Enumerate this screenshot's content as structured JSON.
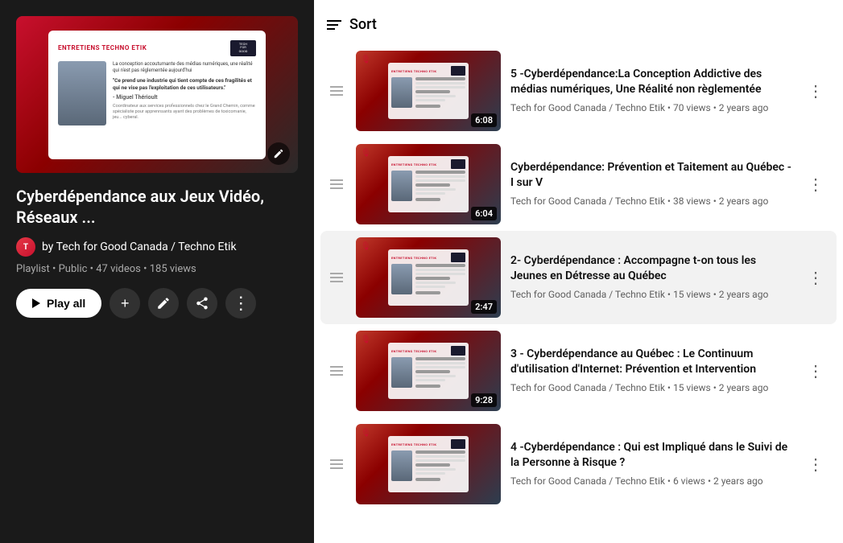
{
  "left_panel": {
    "playlist_title": "Cyberdépendance aux Jeux Vidéo, Réseaux ...",
    "channel_name": "by Tech for Good Canada / Techno Etik",
    "meta": "Playlist • Public • 47 videos • 185 views",
    "play_all_label": "Play all",
    "thumbnail_label": "ENTRETIENS TECHNO ETIK",
    "thumbnail_quote": "\"Ce prend une industrie qui tient compte de ces fragilités et qui ne vise pas l'exploitation de ces utilisateurs.\"",
    "thumbnail_author": "- Miguel Thérioult",
    "thumbnail_author_sub": "Coordinateur aux services professionnels chez le Grand Chemin, comme spécialiste pour apprennsants ayant des problèmes de toxicomanie, jeu... cyberal.",
    "thumbnail_desc": "La conception accoutumante des médias numériques, une réalité qui n'est pas réglementée aujourd'hui"
  },
  "sort_label": "Sort",
  "videos": [
    {
      "id": 1,
      "title": "5 -Cyberdépendance:La Conception Addictive des médias numériques, Une Réalité non règlementée",
      "channel": "Tech for Good Canada / Techno Etik",
      "views": "70 views",
      "age": "2 years ago",
      "duration": "6:08",
      "highlighted": false
    },
    {
      "id": 2,
      "title": "Cyberdépendance: Prévention et Taitement au Québec - I sur V",
      "channel": "Tech for Good Canada / Techno Etik",
      "views": "38 views",
      "age": "2 years ago",
      "duration": "6:04",
      "highlighted": false
    },
    {
      "id": 3,
      "title": "2- Cyberdépendance : Accompagne t-on tous les Jeunes en Détresse au Québec",
      "channel": "Tech for Good Canada / Techno Etik",
      "views": "15 views",
      "age": "2 years ago",
      "duration": "2:47",
      "highlighted": true
    },
    {
      "id": 4,
      "title": "3 - Cyberdépendance au Québec : Le Continuum d'utilisation d'Internet: Prévention et Intervention",
      "channel": "Tech for Good Canada / Techno Etik",
      "views": "15 views",
      "age": "2 years ago",
      "duration": "9:28",
      "highlighted": false
    },
    {
      "id": 5,
      "title": "4 -Cyberdépendance : Qui est Impliqué dans le Suivi de la Personne à Risque ?",
      "channel": "Tech for Good Canada / Techno Etik",
      "views": "6 views",
      "age": "2 years ago",
      "duration": "",
      "highlighted": false
    }
  ],
  "icons": {
    "more_vert": "⋮",
    "add": "+",
    "edit": "✏",
    "share": "↗",
    "mic": "🎙",
    "drag": "≡"
  }
}
